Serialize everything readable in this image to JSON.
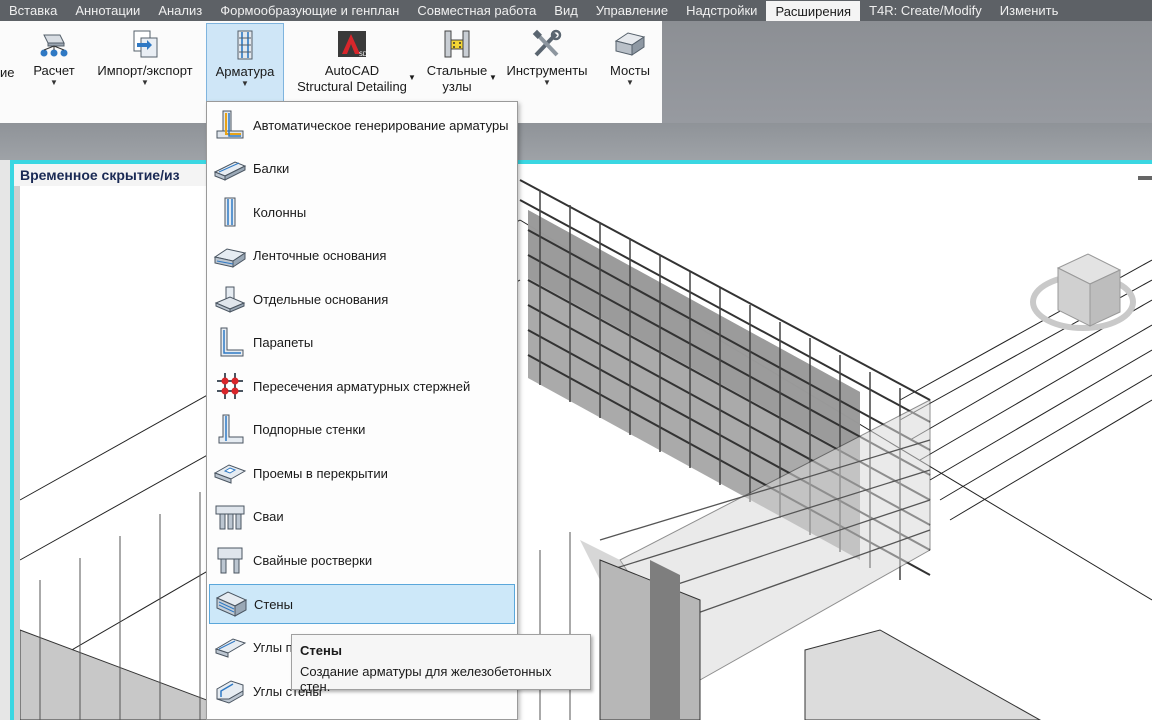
{
  "ribbon_tabs": [
    {
      "label": "Вставка"
    },
    {
      "label": "Аннотации"
    },
    {
      "label": "Анализ"
    },
    {
      "label": "Формообразующие и генплан"
    },
    {
      "label": "Совместная работа"
    },
    {
      "label": "Вид"
    },
    {
      "label": "Управление"
    },
    {
      "label": "Надстройки"
    },
    {
      "label": "Расширения",
      "active": true
    },
    {
      "label": "T4R: Create/Modify"
    },
    {
      "label": "Изменить"
    }
  ],
  "ribbon_buttons": {
    "partial_label": "ие",
    "calc": {
      "label": "Расчет",
      "icon": "calculation-icon"
    },
    "import_export": {
      "label": "Импорт/экспорт",
      "icon": "import-export-icon"
    },
    "rebar": {
      "label": "Арматура",
      "icon": "rebar-icon",
      "pressed": true
    },
    "autocad_sd": {
      "line1": "AutoCAD",
      "line2": "Structural Detailing",
      "icon": "autocad-structural-detailing-icon"
    },
    "steel": {
      "line1": "Стальные",
      "line2": "узлы",
      "icon": "steel-connections-icon"
    },
    "tools": {
      "label": "Инструменты",
      "icon": "tools-icon"
    },
    "bridges": {
      "label": "Мосты",
      "icon": "bridge-icon"
    }
  },
  "viewport": {
    "title": "Временное скрытие/из",
    "accent_color": "#3ad7e2"
  },
  "rebar_menu": {
    "items": [
      {
        "label": "Автоматическое генерирование арматуры",
        "icon": "auto-rebar-icon"
      },
      {
        "label": "Балки",
        "icon": "beam-icon"
      },
      {
        "label": "Колонны",
        "icon": "column-icon"
      },
      {
        "label": "Ленточные основания",
        "icon": "strip-footing-icon"
      },
      {
        "label": "Отдельные основания",
        "icon": "spread-footing-icon"
      },
      {
        "label": "Парапеты",
        "icon": "parapet-icon"
      },
      {
        "label": "Пересечения арматурных стержней",
        "icon": "bar-intersection-icon"
      },
      {
        "label": "Подпорные стенки",
        "icon": "retaining-wall-icon"
      },
      {
        "label": "Проемы в перекрытии",
        "icon": "slab-opening-icon"
      },
      {
        "label": "Сваи",
        "icon": "pile-icon"
      },
      {
        "label": "Свайные ростверки",
        "icon": "pile-cap-icon"
      },
      {
        "label": "Стены",
        "icon": "wall-icon",
        "hover": true
      },
      {
        "label": "Углы п",
        "icon": "wall-corner-icon"
      },
      {
        "label": "Углы стены",
        "icon": "wall-corners-icon"
      }
    ]
  },
  "tooltip": {
    "title": "Стены",
    "body": "Создание арматуры для железобетонных стен."
  },
  "viewcube": {
    "icon": "viewcube-icon"
  }
}
